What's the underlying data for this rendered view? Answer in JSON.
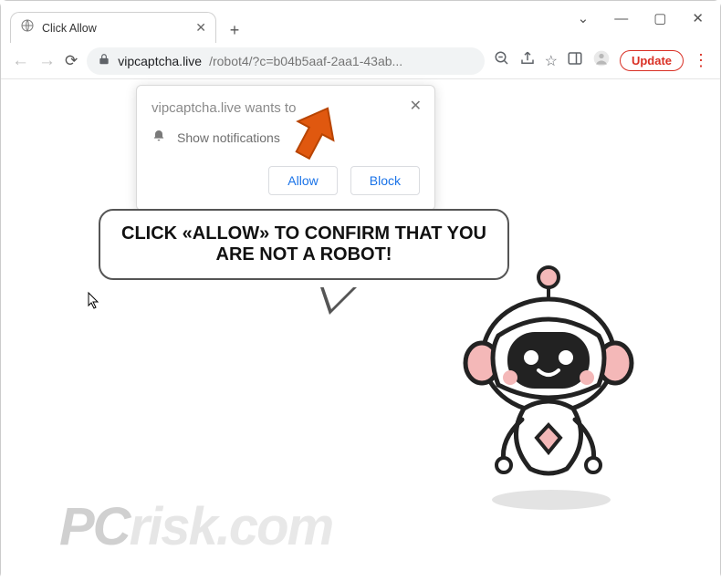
{
  "window": {
    "tab_title": "Click Allow"
  },
  "toolbar": {
    "url_domain": "vipcaptcha.live",
    "url_path": "/robot4/?c=b04b5aaf-2aa1-43ab...",
    "update_label": "Update"
  },
  "permission": {
    "title": "vipcaptcha.live wants to",
    "line": "Show notifications",
    "allow": "Allow",
    "block": "Block"
  },
  "page": {
    "headline": "CLICK «ALLOW» TO CONFIRM THAT YOU ARE NOT A ROBOT!"
  },
  "watermark": {
    "pc": "PC",
    "risk": "risk",
    "com": "com"
  }
}
